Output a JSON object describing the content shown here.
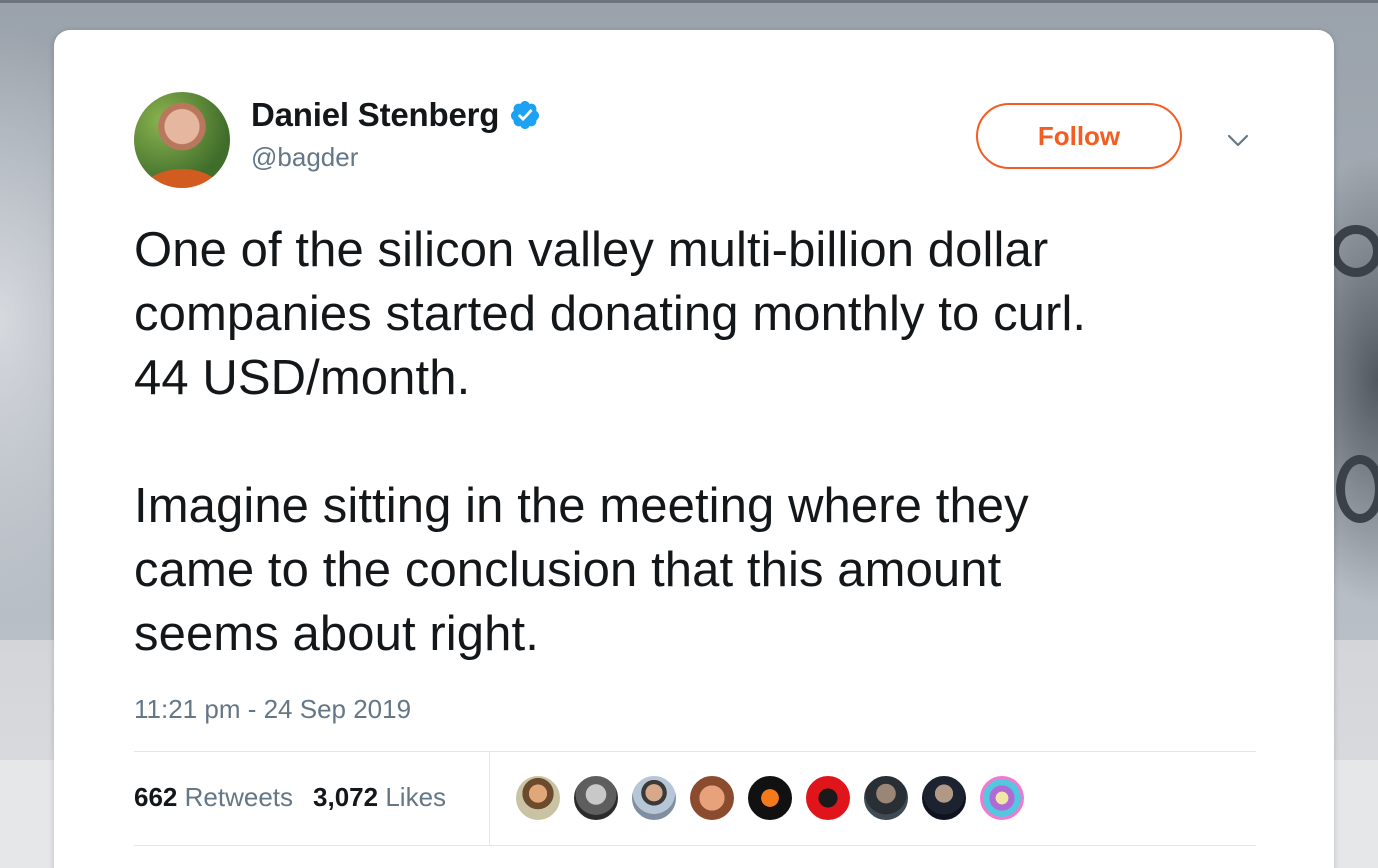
{
  "tweet": {
    "author": {
      "display_name": "Daniel Stenberg",
      "handle": "@bagder",
      "verified": true,
      "avatar_icon": "profile-photo"
    },
    "follow_label": "Follow",
    "text": "One of the silicon valley multi-billion dollar\ncompanies started donating monthly to curl.\n44 USD/month.\n\nImagine sitting in the meeting where they\ncame to the conclusion that this amount\nseems about right.",
    "timestamp": "11:21 pm - 24 Sep 2019",
    "stats": {
      "retweets_count": "662",
      "retweets_label": "Retweets",
      "likes_count": "3,072",
      "likes_label": "Likes"
    },
    "likers": [
      "liker-avatar",
      "liker-avatar",
      "liker-avatar",
      "liker-avatar",
      "liker-avatar",
      "liker-avatar",
      "liker-avatar",
      "liker-avatar",
      "liker-avatar"
    ]
  },
  "colors": {
    "accent": "#f45d22",
    "verified": "#1da1f2",
    "text": "#14171a",
    "secondary_text": "#657786"
  }
}
